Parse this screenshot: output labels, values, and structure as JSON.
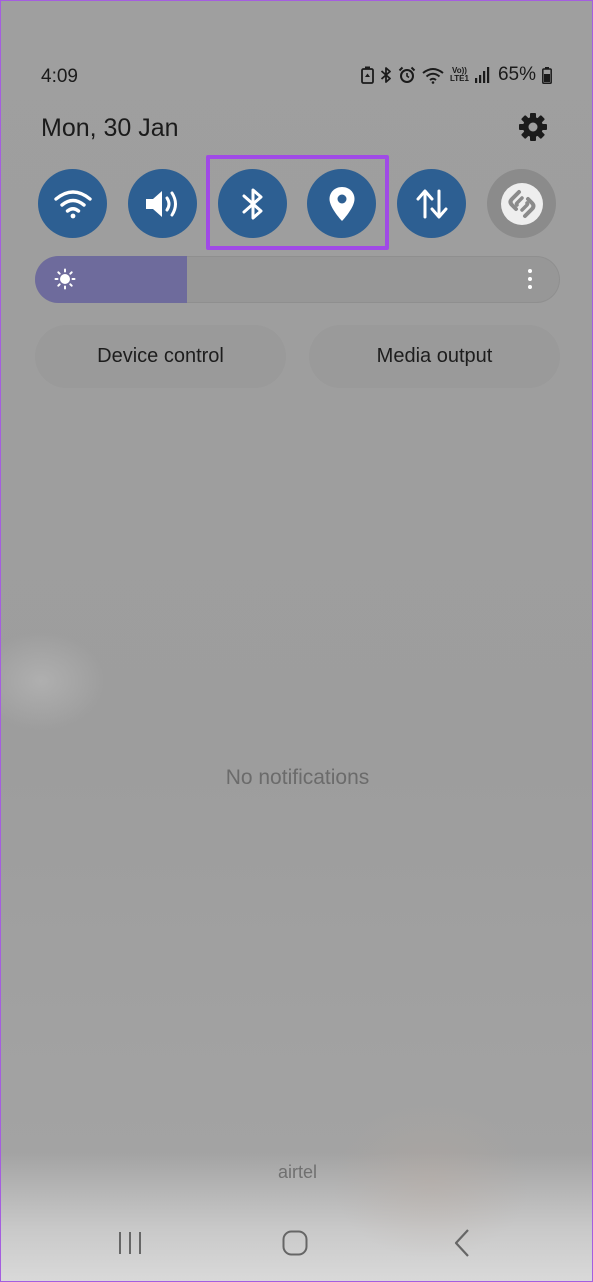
{
  "status_bar": {
    "time": "4:09",
    "volte_line1": "Vo))",
    "volte_line2": "LTE1",
    "battery_percent": "65%",
    "icons": [
      "battery-saver-icon",
      "bluetooth-icon",
      "alarm-icon",
      "wifi-icon",
      "volte-icon",
      "signal-icon",
      "battery-icon"
    ]
  },
  "header": {
    "date": "Mon, 30 Jan",
    "settings_icon": "gear-icon"
  },
  "quick_toggles": [
    {
      "name": "wifi",
      "icon": "wifi-icon",
      "state": "on"
    },
    {
      "name": "sound",
      "icon": "speaker-icon",
      "state": "on"
    },
    {
      "name": "bluetooth",
      "icon": "bluetooth-icon",
      "state": "on"
    },
    {
      "name": "location",
      "icon": "location-pin-icon",
      "state": "on"
    },
    {
      "name": "mobile-data",
      "icon": "data-arrows-icon",
      "state": "on"
    },
    {
      "name": "shazam",
      "icon": "shazam-icon",
      "state": "off"
    }
  ],
  "brightness": {
    "level_percent": 29,
    "icon": "sun-icon"
  },
  "buttons": {
    "device_control": "Device control",
    "media_output": "Media output"
  },
  "notifications": {
    "empty_text": "No notifications"
  },
  "carrier": "airtel",
  "colors": {
    "accent_tile": "#2d5f92",
    "tile_off": "#8b8b8b",
    "highlight": "#a04ae6",
    "brightness_fill": "#6e6b9c"
  }
}
